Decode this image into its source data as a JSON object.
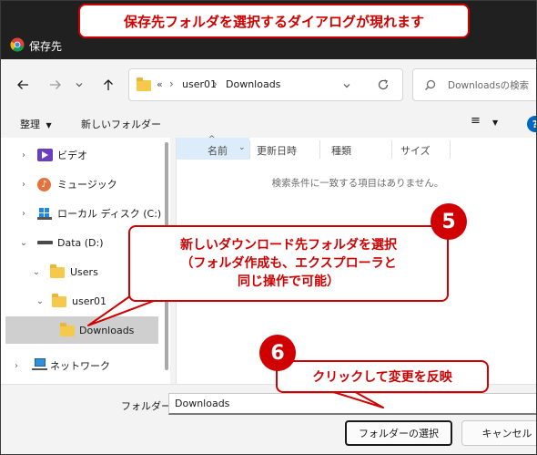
{
  "window": {
    "title": "保存先"
  },
  "address": {
    "overflow": "«",
    "crumbs": [
      "user01",
      "Downloads"
    ],
    "search_placeholder": "Downloadsの検索"
  },
  "commandbar": {
    "organize": "整理",
    "new_folder": "新しいフォルダー"
  },
  "columns": {
    "name": "名前",
    "modified": "更新日時",
    "type": "種類",
    "size": "サイズ"
  },
  "empty_message": "検索条件に一致する項目はありません。",
  "tree": {
    "videos": "ビデオ",
    "music": "ミュージック",
    "local_disk": "ローカル ディスク (C:)",
    "data_drive": "Data (D:)",
    "users": "Users",
    "user01": "user01",
    "downloads": "Downloads",
    "network": "ネットワーク"
  },
  "bottom": {
    "folder_label": "フォルダー:",
    "folder_value": "Downloads",
    "select_button": "フォルダーの選択",
    "cancel_button": "キャンセル"
  },
  "annotations": {
    "top_callout": "保存先フォルダを選択するダイアログが現れます",
    "step5_number": "5",
    "step5_lines": [
      "新しいダウンロード先フォルダを選択",
      "（フォルダ作成も、エクスプローラと",
      "同じ操作で可能）"
    ],
    "step6_number": "6",
    "step6_text": "クリックして変更を反映",
    "accent_color": "#d00000"
  }
}
